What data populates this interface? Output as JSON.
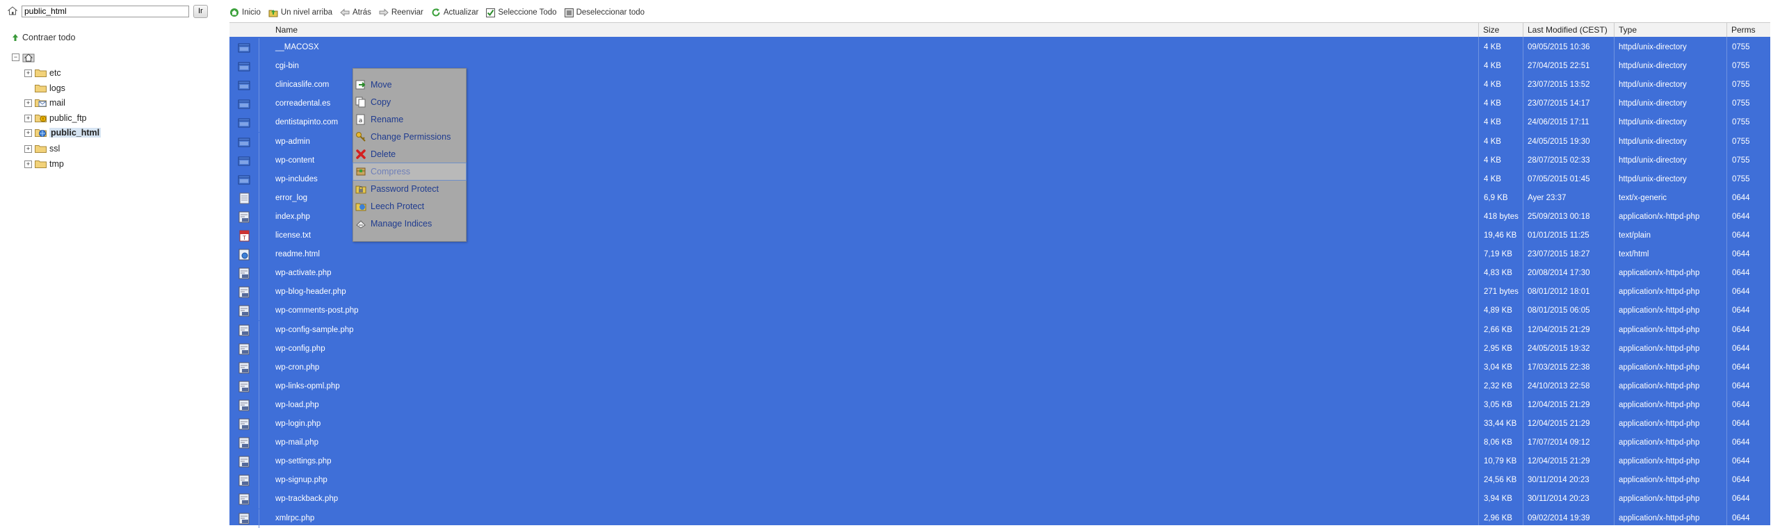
{
  "path_bar": {
    "value": "public_html",
    "go_label": "Ir"
  },
  "tree": {
    "collapse_label": "Contraer todo",
    "items": [
      {
        "label": "etc",
        "expandable": true
      },
      {
        "label": "logs",
        "expandable": false
      },
      {
        "label": "mail",
        "expandable": true
      },
      {
        "label": "public_ftp",
        "expandable": true
      },
      {
        "label": "public_html",
        "expandable": true,
        "selected": true
      },
      {
        "label": "ssl",
        "expandable": true
      },
      {
        "label": "tmp",
        "expandable": true
      }
    ]
  },
  "toolbar": {
    "home": "Inicio",
    "up": "Un nivel arriba",
    "back": "Atrás",
    "forward": "Reenviar",
    "refresh": "Actualizar",
    "select_all": "Seleccione Todo",
    "deselect_all": "Deseleccionar todo"
  },
  "columns": {
    "name": "Name",
    "size": "Size",
    "modified": "Last Modified (CEST)",
    "type": "Type",
    "perms": "Perms"
  },
  "files": [
    {
      "name": "__MACOSX",
      "size": "4 KB",
      "modified": "09/05/2015 10:36",
      "type": "httpd/unix-directory",
      "perms": "0755",
      "icon": "folder"
    },
    {
      "name": "cgi-bin",
      "size": "4 KB",
      "modified": "27/04/2015 22:51",
      "type": "httpd/unix-directory",
      "perms": "0755",
      "icon": "folder"
    },
    {
      "name": "clinicaslife.com",
      "size": "4 KB",
      "modified": "23/07/2015 13:52",
      "type": "httpd/unix-directory",
      "perms": "0755",
      "icon": "folder"
    },
    {
      "name": "correadental.es",
      "size": "4 KB",
      "modified": "23/07/2015 14:17",
      "type": "httpd/unix-directory",
      "perms": "0755",
      "icon": "folder"
    },
    {
      "name": "dentistapinto.com",
      "size": "4 KB",
      "modified": "24/06/2015 17:11",
      "type": "httpd/unix-directory",
      "perms": "0755",
      "icon": "folder"
    },
    {
      "name": "wp-admin",
      "size": "4 KB",
      "modified": "24/05/2015 19:30",
      "type": "httpd/unix-directory",
      "perms": "0755",
      "icon": "folder"
    },
    {
      "name": "wp-content",
      "size": "4 KB",
      "modified": "28/07/2015 02:33",
      "type": "httpd/unix-directory",
      "perms": "0755",
      "icon": "folder"
    },
    {
      "name": "wp-includes",
      "size": "4 KB",
      "modified": "07/05/2015 01:45",
      "type": "httpd/unix-directory",
      "perms": "0755",
      "icon": "folder"
    },
    {
      "name": "error_log",
      "size": "6,9 KB",
      "modified": "Ayer 23:37",
      "type": "text/x-generic",
      "perms": "0644",
      "icon": "generic"
    },
    {
      "name": "index.php",
      "size": "418 bytes",
      "modified": "25/09/2013 00:18",
      "type": "application/x-httpd-php",
      "perms": "0644",
      "icon": "php"
    },
    {
      "name": "license.txt",
      "size": "19,46 KB",
      "modified": "01/01/2015 11:25",
      "type": "text/plain",
      "perms": "0644",
      "icon": "text"
    },
    {
      "name": "readme.html",
      "size": "7,19 KB",
      "modified": "23/07/2015 18:27",
      "type": "text/html",
      "perms": "0644",
      "icon": "html"
    },
    {
      "name": "wp-activate.php",
      "size": "4,83 KB",
      "modified": "20/08/2014 17:30",
      "type": "application/x-httpd-php",
      "perms": "0644",
      "icon": "php"
    },
    {
      "name": "wp-blog-header.php",
      "size": "271 bytes",
      "modified": "08/01/2012 18:01",
      "type": "application/x-httpd-php",
      "perms": "0644",
      "icon": "php"
    },
    {
      "name": "wp-comments-post.php",
      "size": "4,89 KB",
      "modified": "08/01/2015 06:05",
      "type": "application/x-httpd-php",
      "perms": "0644",
      "icon": "php"
    },
    {
      "name": "wp-config-sample.php",
      "size": "2,66 KB",
      "modified": "12/04/2015 21:29",
      "type": "application/x-httpd-php",
      "perms": "0644",
      "icon": "php"
    },
    {
      "name": "wp-config.php",
      "size": "2,95 KB",
      "modified": "24/05/2015 19:32",
      "type": "application/x-httpd-php",
      "perms": "0644",
      "icon": "php"
    },
    {
      "name": "wp-cron.php",
      "size": "3,04 KB",
      "modified": "17/03/2015 22:38",
      "type": "application/x-httpd-php",
      "perms": "0644",
      "icon": "php"
    },
    {
      "name": "wp-links-opml.php",
      "size": "2,32 KB",
      "modified": "24/10/2013 22:58",
      "type": "application/x-httpd-php",
      "perms": "0644",
      "icon": "php"
    },
    {
      "name": "wp-load.php",
      "size": "3,05 KB",
      "modified": "12/04/2015 21:29",
      "type": "application/x-httpd-php",
      "perms": "0644",
      "icon": "php"
    },
    {
      "name": "wp-login.php",
      "size": "33,44 KB",
      "modified": "12/04/2015 21:29",
      "type": "application/x-httpd-php",
      "perms": "0644",
      "icon": "php"
    },
    {
      "name": "wp-mail.php",
      "size": "8,06 KB",
      "modified": "17/07/2014 09:12",
      "type": "application/x-httpd-php",
      "perms": "0644",
      "icon": "php"
    },
    {
      "name": "wp-settings.php",
      "size": "10,79 KB",
      "modified": "12/04/2015 21:29",
      "type": "application/x-httpd-php",
      "perms": "0644",
      "icon": "php"
    },
    {
      "name": "wp-signup.php",
      "size": "24,56 KB",
      "modified": "30/11/2014 20:23",
      "type": "application/x-httpd-php",
      "perms": "0644",
      "icon": "php"
    },
    {
      "name": "wp-trackback.php",
      "size": "3,94 KB",
      "modified": "30/11/2014 20:23",
      "type": "application/x-httpd-php",
      "perms": "0644",
      "icon": "php"
    },
    {
      "name": "xmlrpc.php",
      "size": "2,96 KB",
      "modified": "09/02/2014 19:39",
      "type": "application/x-httpd-php",
      "perms": "0644",
      "icon": "php"
    }
  ],
  "context_menu": {
    "items": [
      {
        "label": "Move",
        "icon": "move-icon"
      },
      {
        "label": "Copy",
        "icon": "copy-icon"
      },
      {
        "label": "Rename",
        "icon": "rename-icon"
      },
      {
        "label": "Change Permissions",
        "icon": "key-icon"
      },
      {
        "label": "Delete",
        "icon": "delete-icon"
      },
      {
        "label": "Compress",
        "icon": "compress-icon",
        "disabled": true
      },
      {
        "label": "Password Protect",
        "icon": "password-protect-icon"
      },
      {
        "label": "Leech Protect",
        "icon": "leech-protect-icon"
      },
      {
        "label": "Manage Indices",
        "icon": "manage-indices-icon"
      }
    ]
  },
  "colors": {
    "selection": "#3f6fd8",
    "menu_bg": "#a8a8a8",
    "menu_text": "#1f3b8f"
  }
}
